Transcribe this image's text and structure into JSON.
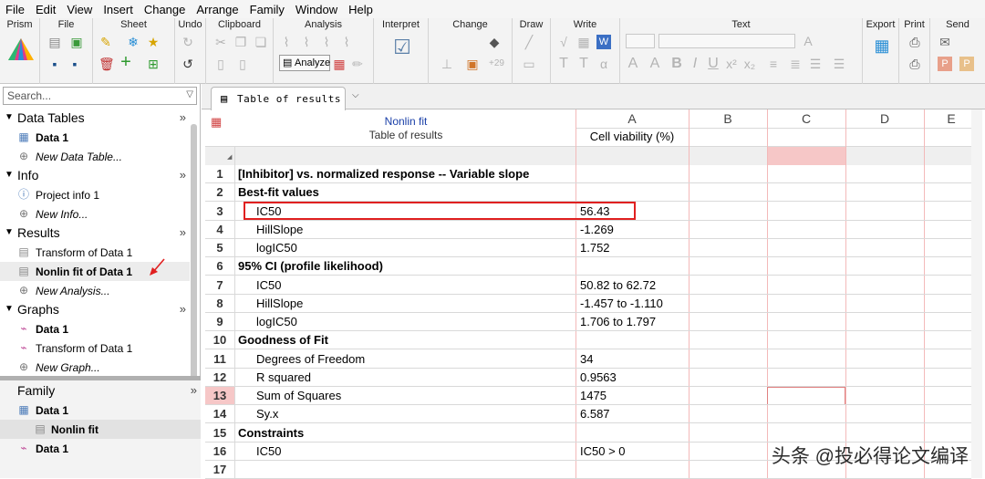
{
  "menu": [
    "File",
    "Edit",
    "View",
    "Insert",
    "Change",
    "Arrange",
    "Family",
    "Window",
    "Help"
  ],
  "ribbon": {
    "groups": [
      "Prism",
      "File",
      "Sheet",
      "Undo",
      "Clipboard",
      "Analysis",
      "Interpret",
      "Change",
      "Draw",
      "Write",
      "Text",
      "Export",
      "Print",
      "Send"
    ],
    "analyze_label": "Analyze",
    "plus29": "+29"
  },
  "search": {
    "placeholder": "Search..."
  },
  "sidebar": {
    "data_tables": {
      "title": "Data Tables",
      "items": [
        "Data 1",
        "New Data Table..."
      ]
    },
    "info": {
      "title": "Info",
      "items": [
        "Project info 1",
        "New Info..."
      ]
    },
    "results": {
      "title": "Results",
      "items": [
        "Transform of Data 1",
        "Nonlin fit of Data 1",
        "New Analysis..."
      ]
    },
    "graphs": {
      "title": "Graphs",
      "items": [
        "Data 1",
        "Transform of Data 1",
        "New Graph..."
      ]
    },
    "family": {
      "title": "Family",
      "items": [
        "Data 1",
        "Nonlin fit",
        "Data 1"
      ]
    }
  },
  "tab": {
    "label": "Table of results"
  },
  "sheet": {
    "header_title": "Nonlin fit",
    "header_subtitle": "Table of results",
    "columns": [
      "A",
      "B",
      "C",
      "D",
      "E"
    ],
    "col_a_title": "Cell viability (%)",
    "rows": [
      {
        "n": "1",
        "label": "[Inhibitor] vs. normalized response -- Variable slope",
        "value": "",
        "bold": true,
        "indent": false
      },
      {
        "n": "2",
        "label": "Best-fit values",
        "value": "",
        "bold": true,
        "indent": false
      },
      {
        "n": "3",
        "label": "IC50",
        "value": "56.43",
        "bold": false,
        "indent": true
      },
      {
        "n": "4",
        "label": "HillSlope",
        "value": "-1.269",
        "bold": false,
        "indent": true
      },
      {
        "n": "5",
        "label": "logIC50",
        "value": "1.752",
        "bold": false,
        "indent": true
      },
      {
        "n": "6",
        "label": "95% CI (profile likelihood)",
        "value": "",
        "bold": true,
        "indent": false
      },
      {
        "n": "7",
        "label": "IC50",
        "value": "50.82 to 62.72",
        "bold": false,
        "indent": true
      },
      {
        "n": "8",
        "label": "HillSlope",
        "value": "-1.457 to -1.110",
        "bold": false,
        "indent": true
      },
      {
        "n": "9",
        "label": "logIC50",
        "value": "1.706 to 1.797",
        "bold": false,
        "indent": true
      },
      {
        "n": "10",
        "label": "Goodness of Fit",
        "value": "",
        "bold": true,
        "indent": false
      },
      {
        "n": "11",
        "label": "Degrees of Freedom",
        "value": "34",
        "bold": false,
        "indent": true
      },
      {
        "n": "12",
        "label": "R squared",
        "value": "0.9563",
        "bold": false,
        "indent": true
      },
      {
        "n": "13",
        "label": "Sum of Squares",
        "value": "1475",
        "bold": false,
        "indent": true
      },
      {
        "n": "14",
        "label": "Sy.x",
        "value": "6.587",
        "bold": false,
        "indent": true
      },
      {
        "n": "15",
        "label": "Constraints",
        "value": "",
        "bold": true,
        "indent": false
      },
      {
        "n": "16",
        "label": "IC50",
        "value": "IC50 > 0",
        "bold": false,
        "indent": true
      },
      {
        "n": "17",
        "label": "",
        "value": "",
        "bold": false,
        "indent": false
      }
    ]
  },
  "watermark": "头条 @投必得论文编译",
  "colors": {
    "accent_red": "#e02020",
    "selected_row_pink": "#f6c7c7"
  }
}
